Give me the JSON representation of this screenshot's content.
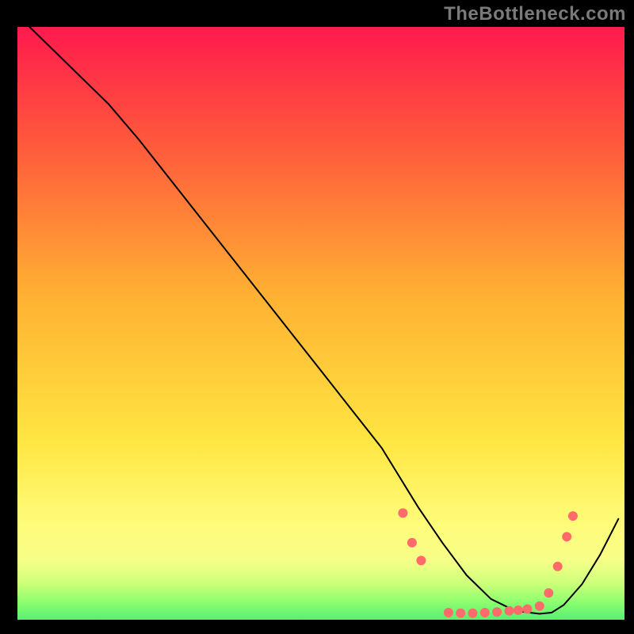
{
  "watermark": "TheBottleneck.com",
  "chart_data": {
    "type": "line",
    "title": "",
    "xlabel": "",
    "ylabel": "",
    "xlim": [
      0,
      100
    ],
    "ylim": [
      0,
      100
    ],
    "background_gradient": {
      "direction": "vertical",
      "stops": [
        {
          "offset": 0.0,
          "color": "#ff1a4d"
        },
        {
          "offset": 0.2,
          "color": "#ff5a3c"
        },
        {
          "offset": 0.45,
          "color": "#ffb032"
        },
        {
          "offset": 0.7,
          "color": "#ffe642"
        },
        {
          "offset": 0.84,
          "color": "#fffb7a"
        },
        {
          "offset": 0.9,
          "color": "#f4ff8c"
        },
        {
          "offset": 0.94,
          "color": "#b8ff7a"
        },
        {
          "offset": 0.97,
          "color": "#5aff6a"
        },
        {
          "offset": 1.0,
          "color": "#00e676"
        }
      ]
    },
    "band_overlay": {
      "from_y": 72,
      "to_y": 100,
      "color_top": "rgba(255,255,120,0.0)",
      "color_bottom": "rgba(255,255,120,0.35)"
    },
    "series": [
      {
        "name": "curve",
        "color": "#000000",
        "stroke_width": 2,
        "x": [
          2,
          6,
          10,
          15,
          20,
          25,
          30,
          35,
          40,
          45,
          50,
          55,
          60,
          63,
          66,
          70,
          74,
          78,
          82,
          86,
          88,
          90,
          93,
          96,
          99
        ],
        "y": [
          100,
          96,
          92,
          87,
          81,
          74.5,
          68,
          61.5,
          55,
          48.5,
          42,
          35.5,
          29,
          24,
          19,
          13,
          7.5,
          3.5,
          1.5,
          1.0,
          1.2,
          2.5,
          6,
          11,
          17
        ]
      }
    ],
    "markers": {
      "name": "dots",
      "color": "#ff6b6b",
      "radius": 6,
      "x": [
        63.5,
        65,
        66.5,
        71,
        73,
        75,
        77,
        79,
        81,
        82.5,
        84,
        86,
        87.5,
        89,
        90.5,
        91.5
      ],
      "y": [
        18,
        13,
        10,
        1.2,
        1.1,
        1.1,
        1.2,
        1.3,
        1.5,
        1.6,
        1.8,
        2.3,
        4.5,
        9,
        14,
        17.5
      ]
    }
  }
}
